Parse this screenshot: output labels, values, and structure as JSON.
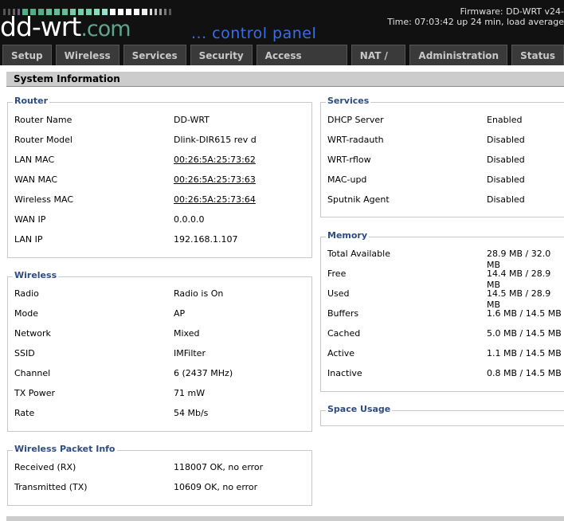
{
  "header": {
    "logo_main": "dd-wrt",
    "logo_tld": ".com",
    "tagline": "... control panel",
    "firmware_line": "Firmware: DD-WRT v24-",
    "time_line": "Time: 07:03:42 up 24 min, load average"
  },
  "colors": {
    "header_bg": "#111111",
    "logo_green": "#5fa58e",
    "tagline_blue": "#3a6ee8",
    "legend_blue": "#2d4c82",
    "section_header_bg": "#cccccc"
  },
  "tabs": [
    {
      "label": "Setup"
    },
    {
      "label": "Wireless"
    },
    {
      "label": "Services"
    },
    {
      "label": "Security"
    },
    {
      "label": "Access Restrictions"
    },
    {
      "label": "NAT / QoS"
    },
    {
      "label": "Administration"
    },
    {
      "label": "Status"
    }
  ],
  "section_title": "System Information",
  "router": {
    "legend": "Router",
    "rows": [
      {
        "label": "Router Name",
        "value": "DD-WRT"
      },
      {
        "label": "Router Model",
        "value": "Dlink-DIR615 rev d"
      },
      {
        "label": "LAN MAC",
        "value": "00:26:5A:25:73:62"
      },
      {
        "label": "WAN MAC",
        "value": "00:26:5A:25:73:63"
      },
      {
        "label": "Wireless MAC",
        "value": "00:26:5A:25:73:64"
      },
      {
        "label": "WAN IP",
        "value": "0.0.0.0"
      },
      {
        "label": "LAN IP",
        "value": "192.168.1.107"
      }
    ]
  },
  "wireless": {
    "legend": "Wireless",
    "rows": [
      {
        "label": "Radio",
        "value": "Radio is On"
      },
      {
        "label": "Mode",
        "value": "AP"
      },
      {
        "label": "Network",
        "value": "Mixed"
      },
      {
        "label": "SSID",
        "value": "IMFilter"
      },
      {
        "label": "Channel",
        "value": "6 (2437 MHz)"
      },
      {
        "label": "TX Power",
        "value": "71 mW"
      },
      {
        "label": "Rate",
        "value": "54 Mb/s"
      }
    ]
  },
  "packet_info": {
    "legend": "Wireless Packet Info",
    "rows": [
      {
        "label": "Received (RX)",
        "value": "118007 OK, no error"
      },
      {
        "label": "Transmitted (TX)",
        "value": "10609 OK, no error"
      }
    ]
  },
  "services": {
    "legend": "Services",
    "rows": [
      {
        "label": "DHCP Server",
        "value": "Enabled"
      },
      {
        "label": "WRT-radauth",
        "value": "Disabled"
      },
      {
        "label": "WRT-rflow",
        "value": "Disabled"
      },
      {
        "label": "MAC-upd",
        "value": "Disabled"
      },
      {
        "label": "Sputnik Agent",
        "value": "Disabled"
      }
    ]
  },
  "memory": {
    "legend": "Memory",
    "rows": [
      {
        "label": "Total Available",
        "value": "28.9 MB / 32.0 MB"
      },
      {
        "label": "Free",
        "value": "14.4 MB / 28.9 MB"
      },
      {
        "label": "Used",
        "value": "14.5 MB / 28.9 MB"
      },
      {
        "label": "Buffers",
        "value": "1.6 MB / 14.5 MB"
      },
      {
        "label": "Cached",
        "value": "5.0 MB / 14.5 MB"
      },
      {
        "label": "Active",
        "value": "1.1 MB / 14.5 MB"
      },
      {
        "label": "Inactive",
        "value": "0.8 MB / 14.5 MB"
      }
    ]
  },
  "space_usage": {
    "legend": "Space Usage"
  }
}
